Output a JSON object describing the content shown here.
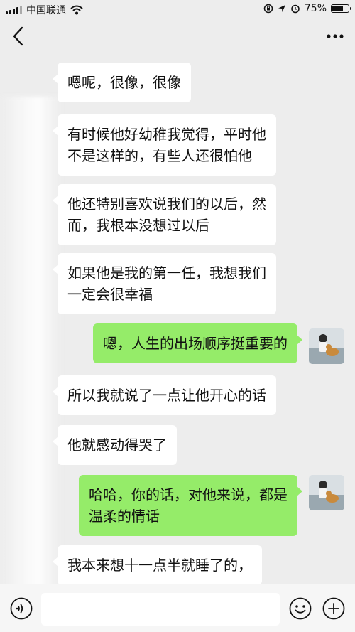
{
  "status_bar": {
    "carrier": "中国联通",
    "battery_percent": "75%",
    "battery_level": 0.75,
    "icons": [
      "signal-icon",
      "wifi-icon",
      "rotation-lock-icon",
      "location-icon",
      "alarm-icon",
      "battery-icon"
    ]
  },
  "nav": {
    "back_icon": "chevron-left-icon",
    "more_icon": "more-dots-icon"
  },
  "messages": [
    {
      "side": "left",
      "text": "嗯呢，很像，很像"
    },
    {
      "side": "left",
      "text": "有时候他好幼稚我觉得，平时他\n不是这样的，有些人还很怕他"
    },
    {
      "side": "left",
      "text": "他还特别喜欢说我们的以后，然\n而，我根本没想过以后"
    },
    {
      "side": "left",
      "text": "如果他是我的第一任，我想我们\n一定会很幸福"
    },
    {
      "side": "right",
      "text": "嗯，人生的出场顺序挺重要的"
    },
    {
      "side": "left",
      "text": "所以我就说了一点让他开心的话"
    },
    {
      "side": "left",
      "text": "他就感动得哭了"
    },
    {
      "side": "right",
      "text": "哈哈，你的话，对他来说，都是\n温柔的情话"
    },
    {
      "side": "left",
      "text": "我本来想十一点半就睡了的，"
    }
  ],
  "input_bar": {
    "voice_icon": "voice-icon",
    "input_value": "",
    "emoji_icon": "emoji-icon",
    "plus_icon": "plus-icon"
  },
  "colors": {
    "background": "#ededed",
    "sent_bubble": "#95ec69",
    "received_bubble": "#ffffff"
  }
}
